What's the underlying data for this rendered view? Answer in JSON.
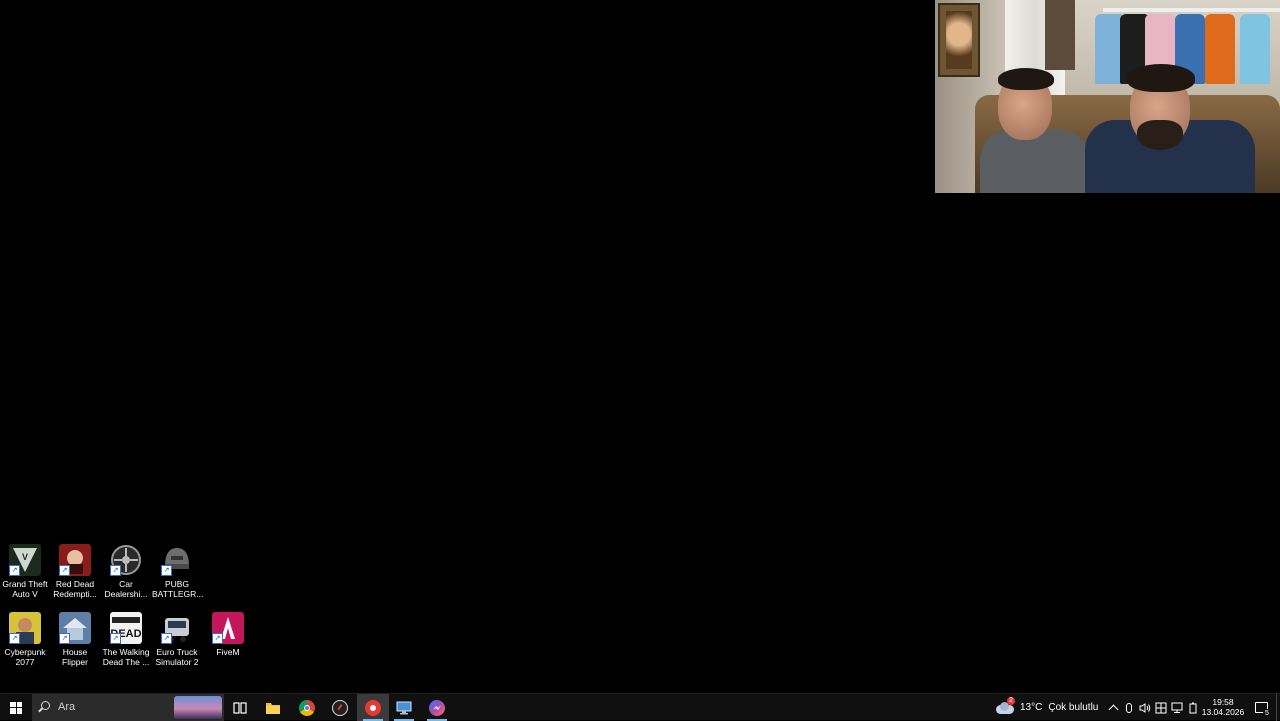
{
  "desktop": {
    "icons": [
      {
        "label_line1": "Grand Theft",
        "label_line2": "Auto V",
        "icon": "gta-v-icon",
        "color": "#2b3b2a"
      },
      {
        "label_line1": "Red Dead",
        "label_line2": "Redempti...",
        "icon": "red-dead-icon",
        "color": "#8a1c1c"
      },
      {
        "label_line1": "Car",
        "label_line2": "Dealershi...",
        "icon": "car-wheel-icon",
        "color": "#2a2a2a"
      },
      {
        "label_line1": "PUBG",
        "label_line2": "BATTLEGR...",
        "icon": "pubg-helmet-icon",
        "color": "#5d5d5d"
      },
      {
        "label_line1": "Cyberpunk",
        "label_line2": "2077",
        "icon": "cyberpunk-icon",
        "color": "#d7c23a"
      },
      {
        "label_line1": "House",
        "label_line2": "Flipper",
        "icon": "house-flipper-icon",
        "color": "#5d7fa6"
      },
      {
        "label_line1": "The Walking",
        "label_line2": "Dead The ...",
        "icon": "walking-dead-icon",
        "color": "#f2f2f2"
      },
      {
        "label_line1": "Euro Truck",
        "label_line2": "Simulator 2",
        "icon": "euro-truck-icon",
        "color": "#3b4a5e"
      },
      {
        "label_line1": "FiveM",
        "label_line2": "",
        "icon": "fivem-icon",
        "color": "#c2185b"
      }
    ]
  },
  "taskbar": {
    "search_placeholder": "Ara",
    "apps": [
      "task-view-icon",
      "file-explorer-icon",
      "chrome-icon",
      "speedometer-app-icon",
      "recording-app-icon",
      "remote-desktop-icon",
      "messenger-icon"
    ],
    "weather": {
      "badge": "2",
      "temp": "13°C",
      "desc": "Çok bulutlu"
    },
    "clock": {
      "time": "19:58",
      "date": "13.04.2026"
    },
    "notifications": "5"
  },
  "colors": {
    "accent": "#76b9ed",
    "taskbar": "#101010"
  }
}
